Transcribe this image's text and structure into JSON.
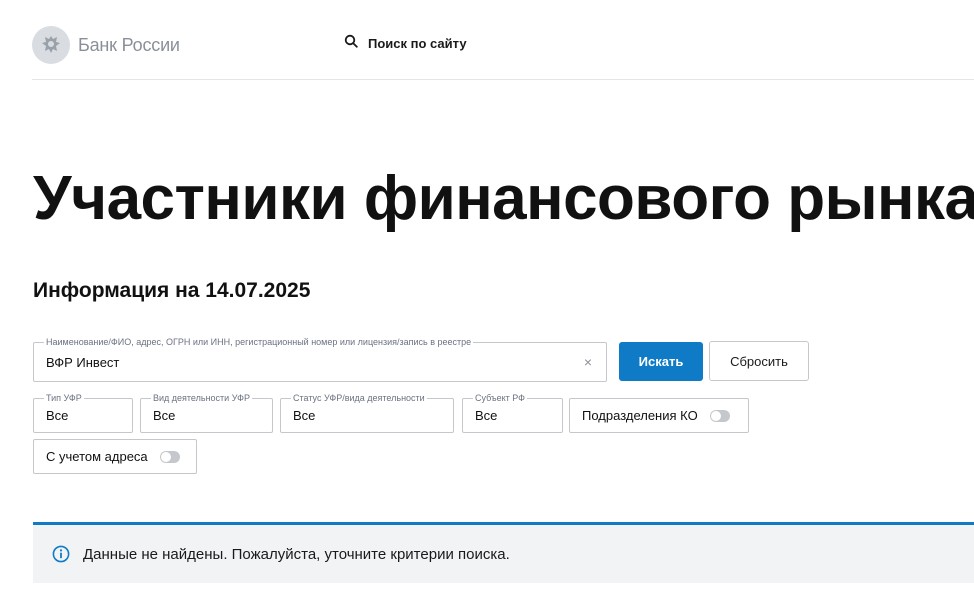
{
  "header": {
    "brand": "Банк России",
    "site_search_label": "Поиск по сайту"
  },
  "page": {
    "title": "Участники финансового рынка",
    "info_date": "Информация на 14.07.2025"
  },
  "search": {
    "legend": "Наименование/ФИО, адрес, ОГРН или ИНН, регистрационный номер или лицензия/запись в реестре",
    "value": "ВФР Инвест",
    "clear_symbol": "×",
    "submit_label": "Искать",
    "reset_label": "Сбросить"
  },
  "filters": [
    {
      "legend": "Тип УФР",
      "value": "Все"
    },
    {
      "legend": "Вид деятельности УФР",
      "value": "Все"
    },
    {
      "legend": "Статус УФР/вида деятельности",
      "value": "Все"
    },
    {
      "legend": "Субъект РФ",
      "value": "Все"
    }
  ],
  "toggles": {
    "subdivisions": {
      "label": "Подразделения КО",
      "on": false
    },
    "with_address": {
      "label": "С учетом адреса",
      "on": false
    }
  },
  "alert": {
    "icon": "info-icon",
    "text": "Данные не найдены. Пожалуйста, уточните критерии поиска."
  },
  "colors": {
    "accent": "#0f7bc7",
    "alert_bg": "#f1f3f5",
    "brand_text": "#8a9099"
  }
}
